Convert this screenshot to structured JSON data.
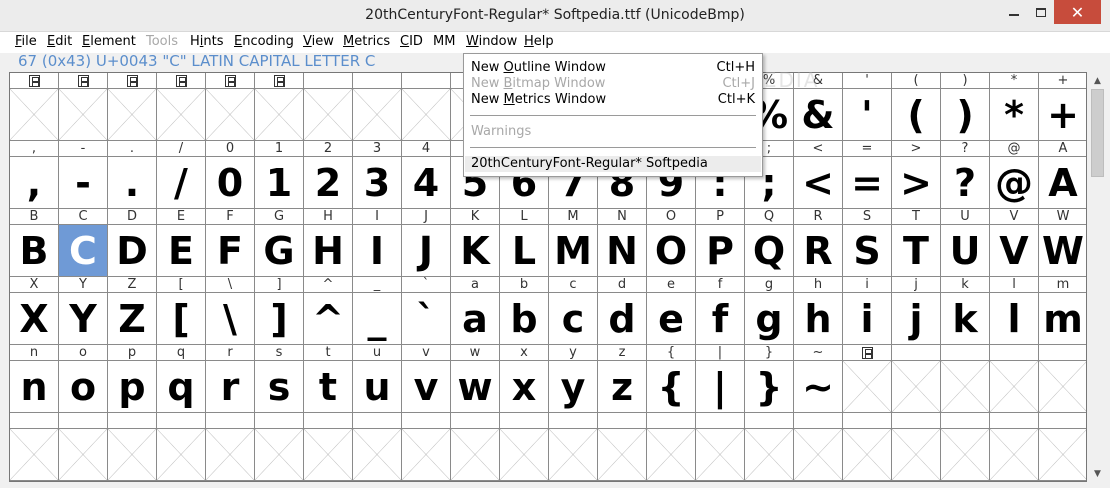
{
  "window": {
    "title": "20thCenturyFont-Regular*  Softpedia.ttf (UnicodeBmp)",
    "minimize": "minimize-icon",
    "maximize": "maximize-icon",
    "close": "✕"
  },
  "menu": {
    "items": [
      {
        "label": "File",
        "u": "F",
        "rest": "ile",
        "disabled": false
      },
      {
        "label": "Edit",
        "u": "E",
        "rest": "dit",
        "disabled": false
      },
      {
        "label": "Element",
        "u": "E",
        "rest": "lement",
        "disabled": false
      },
      {
        "label": "Tools",
        "u": "",
        "rest": "Tools",
        "disabled": true
      },
      {
        "label": "Hints",
        "pre": "H",
        "u": "i",
        "rest": "nts",
        "disabled": false
      },
      {
        "label": "Encoding",
        "u": "E",
        "rest": "ncoding",
        "disabled": false
      },
      {
        "label": "View",
        "u": "V",
        "rest": "iew",
        "disabled": false
      },
      {
        "label": "Metrics",
        "u": "M",
        "rest": "etrics",
        "disabled": false
      },
      {
        "label": "CID",
        "u": "C",
        "rest": "ID",
        "disabled": false
      },
      {
        "label": "MM",
        "u": "",
        "rest": "MM",
        "disabled": false
      },
      {
        "label": "Window",
        "u": "W",
        "rest": "indow",
        "disabled": false
      },
      {
        "label": "Help",
        "u": "H",
        "rest": "elp",
        "disabled": false
      }
    ]
  },
  "info": "67 (0x43) U+0043 \"C\" LATIN CAPITAL LETTER C",
  "watermark": "SOFTPEDIA",
  "window_menu": {
    "items": [
      {
        "pre": "New ",
        "u": "O",
        "post": "utline Window",
        "shortcut": "Ctl+H",
        "disabled": false
      },
      {
        "pre": "New ",
        "u": "B",
        "post": "itmap Window",
        "shortcut": "Ctl+J",
        "disabled": true
      },
      {
        "pre": "New ",
        "u": "M",
        "post": "etrics Window",
        "shortcut": "Ctl+K",
        "disabled": false
      },
      {
        "pre": "",
        "u": "",
        "post": "Warnings",
        "shortcut": "",
        "disabled": true
      },
      {
        "pre": "",
        "u": "",
        "post": "20thCentury​Font-Regular*  Softpedia",
        "shortcut": "",
        "disabled": false
      }
    ]
  },
  "grid": {
    "selected": "C",
    "rows": [
      [
        {
          "l": "notdef",
          "g": ""
        },
        {
          "l": "notdef",
          "g": ""
        },
        {
          "l": "notdef",
          "g": ""
        },
        {
          "l": "notdef",
          "g": ""
        },
        {
          "l": "notdef",
          "g": ""
        },
        {
          "l": "notdef",
          "g": ""
        },
        {
          "l": "",
          "g": ""
        },
        {
          "l": "",
          "g": ""
        },
        {
          "l": "",
          "g": ""
        },
        {
          "l": "",
          "g": ""
        },
        {
          "l": "",
          "g": ""
        },
        {
          "l": "",
          "g": ""
        },
        {
          "l": "",
          "g": ""
        },
        {
          "l": "",
          "g": ""
        },
        {
          "l": "",
          "g": ""
        },
        {
          "l": "%",
          "g": "%"
        },
        {
          "l": "&",
          "g": "&"
        },
        {
          "l": "'",
          "g": "'"
        },
        {
          "l": "(",
          "g": "("
        },
        {
          "l": ")",
          "g": ")"
        },
        {
          "l": "*",
          "g": "*"
        },
        {
          "l": "+",
          "g": "+"
        }
      ],
      [
        {
          "l": ",",
          "g": ","
        },
        {
          "l": "-",
          "g": "-"
        },
        {
          "l": ".",
          "g": "."
        },
        {
          "l": "/",
          "g": "/"
        },
        {
          "l": "0",
          "g": "0"
        },
        {
          "l": "1",
          "g": "1"
        },
        {
          "l": "2",
          "g": "2"
        },
        {
          "l": "3",
          "g": "3"
        },
        {
          "l": "4",
          "g": "4"
        },
        {
          "l": "5",
          "g": "5"
        },
        {
          "l": "6",
          "g": "6"
        },
        {
          "l": "7",
          "g": "7"
        },
        {
          "l": "8",
          "g": "8"
        },
        {
          "l": "9",
          "g": "9"
        },
        {
          "l": ":",
          "g": ":"
        },
        {
          "l": ";",
          "g": ";"
        },
        {
          "l": "<",
          "g": "<"
        },
        {
          "l": "=",
          "g": "="
        },
        {
          "l": ">",
          "g": ">"
        },
        {
          "l": "?",
          "g": "?"
        },
        {
          "l": "@",
          "g": "@"
        },
        {
          "l": "A",
          "g": "A"
        }
      ],
      [
        {
          "l": "B",
          "g": "B"
        },
        {
          "l": "C",
          "g": "C"
        },
        {
          "l": "D",
          "g": "D"
        },
        {
          "l": "E",
          "g": "E"
        },
        {
          "l": "F",
          "g": "F"
        },
        {
          "l": "G",
          "g": "G"
        },
        {
          "l": "H",
          "g": "H"
        },
        {
          "l": "I",
          "g": "I"
        },
        {
          "l": "J",
          "g": "J"
        },
        {
          "l": "K",
          "g": "K"
        },
        {
          "l": "L",
          "g": "L"
        },
        {
          "l": "M",
          "g": "M"
        },
        {
          "l": "N",
          "g": "N"
        },
        {
          "l": "O",
          "g": "O"
        },
        {
          "l": "P",
          "g": "P"
        },
        {
          "l": "Q",
          "g": "Q"
        },
        {
          "l": "R",
          "g": "R"
        },
        {
          "l": "S",
          "g": "S"
        },
        {
          "l": "T",
          "g": "T"
        },
        {
          "l": "U",
          "g": "U"
        },
        {
          "l": "V",
          "g": "V"
        },
        {
          "l": "W",
          "g": "W"
        }
      ],
      [
        {
          "l": "X",
          "g": "X"
        },
        {
          "l": "Y",
          "g": "Y"
        },
        {
          "l": "Z",
          "g": "Z"
        },
        {
          "l": "[",
          "g": "["
        },
        {
          "l": "\\",
          "g": "\\"
        },
        {
          "l": "]",
          "g": "]"
        },
        {
          "l": "^",
          "g": "^"
        },
        {
          "l": "_",
          "g": "_"
        },
        {
          "l": "`",
          "g": "`"
        },
        {
          "l": "a",
          "g": "a"
        },
        {
          "l": "b",
          "g": "b"
        },
        {
          "l": "c",
          "g": "c"
        },
        {
          "l": "d",
          "g": "d"
        },
        {
          "l": "e",
          "g": "e"
        },
        {
          "l": "f",
          "g": "f"
        },
        {
          "l": "g",
          "g": "g"
        },
        {
          "l": "h",
          "g": "h"
        },
        {
          "l": "i",
          "g": "i"
        },
        {
          "l": "j",
          "g": "j"
        },
        {
          "l": "k",
          "g": "k"
        },
        {
          "l": "l",
          "g": "l"
        },
        {
          "l": "m",
          "g": "m"
        }
      ],
      [
        {
          "l": "n",
          "g": "n"
        },
        {
          "l": "o",
          "g": "o"
        },
        {
          "l": "p",
          "g": "p"
        },
        {
          "l": "q",
          "g": "q"
        },
        {
          "l": "r",
          "g": "r"
        },
        {
          "l": "s",
          "g": "s"
        },
        {
          "l": "t",
          "g": "t"
        },
        {
          "l": "u",
          "g": "u"
        },
        {
          "l": "v",
          "g": "v"
        },
        {
          "l": "w",
          "g": "w"
        },
        {
          "l": "x",
          "g": "x"
        },
        {
          "l": "y",
          "g": "y"
        },
        {
          "l": "z",
          "g": "z"
        },
        {
          "l": "{",
          "g": "{"
        },
        {
          "l": "|",
          "g": "|"
        },
        {
          "l": "}",
          "g": "}"
        },
        {
          "l": "~",
          "g": "~"
        },
        {
          "l": "notdef",
          "g": ""
        },
        {
          "l": "",
          "g": ""
        },
        {
          "l": "",
          "g": ""
        },
        {
          "l": "",
          "g": ""
        },
        {
          "l": "",
          "g": ""
        }
      ],
      [
        {
          "l": "",
          "g": ""
        },
        {
          "l": "",
          "g": ""
        },
        {
          "l": "",
          "g": ""
        },
        {
          "l": "",
          "g": ""
        },
        {
          "l": "",
          "g": ""
        },
        {
          "l": "",
          "g": ""
        },
        {
          "l": "",
          "g": ""
        },
        {
          "l": "",
          "g": ""
        },
        {
          "l": "",
          "g": ""
        },
        {
          "l": "",
          "g": ""
        },
        {
          "l": "",
          "g": ""
        },
        {
          "l": "",
          "g": ""
        },
        {
          "l": "",
          "g": ""
        },
        {
          "l": "",
          "g": ""
        },
        {
          "l": "",
          "g": ""
        },
        {
          "l": "",
          "g": ""
        },
        {
          "l": "",
          "g": ""
        },
        {
          "l": "",
          "g": ""
        },
        {
          "l": "",
          "g": ""
        },
        {
          "l": "",
          "g": ""
        },
        {
          "l": "",
          "g": ""
        },
        {
          "l": "",
          "g": ""
        }
      ]
    ]
  }
}
